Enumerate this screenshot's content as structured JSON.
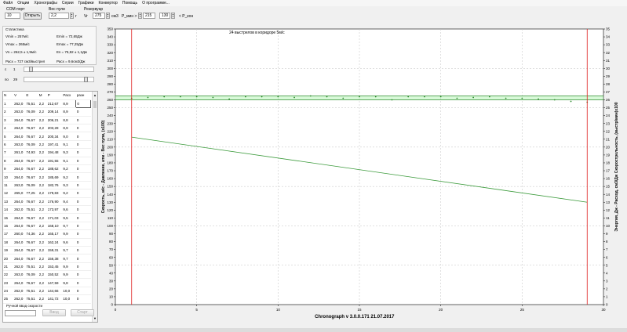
{
  "menu": [
    "Файл",
    "Опции",
    "Хронографы",
    "Серии",
    "Графики",
    "Конвертор",
    "Помощь",
    "О программе..."
  ],
  "toolbar": {
    "com_label": "COM порт",
    "com_value": "10",
    "open_button": "Открыть",
    "weight_label": "Вес пули",
    "weight_value": "2,2",
    "weight_unit": "г",
    "tank_label": "Резервуар",
    "vr_label": "Vr",
    "vr_value": "275",
    "vr_unit": "см3",
    "pmin_label": "P_мин >",
    "pmin_value": "215",
    "pkon_value": "130",
    "pkon_label": "< P_кон"
  },
  "stats": {
    "title": "Статистика",
    "vmin": "Vmin = 257м/с",
    "emin": "Emin = 72,65Дж",
    "vmax": "Vmax = 265м/с",
    "emax": "Emax = 77,25Дж",
    "vavg": "Vs = 262,5 ± 1,9м/с",
    "eavg": "Es = 75,82 ± 1,1Дж",
    "flow": "Расх = 727 см3/выстрел",
    "flow2": "Расх = 9,6см3/Дж"
  },
  "range": {
    "from_label": "с",
    "from_value": "1",
    "to_label": "по",
    "to_value": "29"
  },
  "table": {
    "headers": [
      "N",
      "V",
      "E",
      "M",
      "P",
      "Расх",
      "разн"
    ],
    "rows": [
      [
        "1",
        "262,0",
        "75,51",
        "2,2",
        "212,67",
        "8,9",
        "0"
      ],
      [
        "2",
        "263,0",
        "76,09",
        "2,2",
        "209,14",
        "8,9",
        "0"
      ],
      [
        "3",
        "264,0",
        "76,67",
        "2,2",
        "206,21",
        "8,8",
        "0"
      ],
      [
        "4",
        "264,0",
        "76,67",
        "2,2",
        "203,28",
        "8,9",
        "0"
      ],
      [
        "5",
        "264,0",
        "76,67",
        "2,2",
        "200,34",
        "9,0",
        "0"
      ],
      [
        "6",
        "263,0",
        "76,09",
        "2,2",
        "197,41",
        "9,1",
        "0"
      ],
      [
        "7",
        "261,0",
        "74,93",
        "2,2",
        "194,48",
        "9,3",
        "0"
      ],
      [
        "8",
        "264,0",
        "76,67",
        "2,2",
        "191,55",
        "9,1",
        "0"
      ],
      [
        "9",
        "264,0",
        "76,67",
        "2,2",
        "188,62",
        "9,2",
        "0"
      ],
      [
        "10",
        "264,0",
        "76,67",
        "2,2",
        "185,69",
        "9,2",
        "0"
      ],
      [
        "11",
        "263,0",
        "76,09",
        "2,2",
        "182,76",
        "9,3",
        "0"
      ],
      [
        "12",
        "265,0",
        "77,25",
        "2,2",
        "179,83",
        "9,2",
        "0"
      ],
      [
        "13",
        "264,0",
        "76,67",
        "2,2",
        "176,90",
        "9,4",
        "0"
      ],
      [
        "14",
        "262,0",
        "75,51",
        "2,2",
        "173,97",
        "9,6",
        "0"
      ],
      [
        "15",
        "264,0",
        "76,67",
        "2,2",
        "171,03",
        "9,5",
        "0"
      ],
      [
        "16",
        "264,0",
        "76,67",
        "2,2",
        "168,10",
        "9,7",
        "0"
      ],
      [
        "17",
        "260,0",
        "74,36",
        "2,2",
        "165,17",
        "9,9",
        "0"
      ],
      [
        "18",
        "264,0",
        "76,67",
        "2,2",
        "162,24",
        "9,6",
        "0"
      ],
      [
        "19",
        "264,0",
        "76,67",
        "2,2",
        "159,31",
        "9,7",
        "0"
      ],
      [
        "20",
        "264,0",
        "76,67",
        "2,2",
        "156,38",
        "9,7",
        "0"
      ],
      [
        "21",
        "262,0",
        "75,51",
        "2,2",
        "153,45",
        "9,9",
        "0"
      ],
      [
        "22",
        "263,0",
        "76,09",
        "2,2",
        "150,52",
        "9,9",
        "0"
      ],
      [
        "23",
        "264,0",
        "76,67",
        "2,2",
        "147,59",
        "9,8",
        "0"
      ],
      [
        "24",
        "262,0",
        "75,51",
        "2,2",
        "144,66",
        "10,0",
        "0"
      ],
      [
        "25",
        "262,0",
        "75,51",
        "2,2",
        "141,72",
        "10,0",
        "0"
      ]
    ]
  },
  "manual": {
    "label": "Ручной ввод скорости",
    "enter_button": "Ввод",
    "start_button": "Старт"
  },
  "chart_data": {
    "type": "line",
    "title": "24 выстрелов в коридоре 5м/с",
    "footer": "Chronograph v 3.0.0.171      21.07.2017",
    "ylabel_left": "Скорость, м/с  -  Давление, атм  -  Вес пули, (х100)",
    "ylabel_right": "Энергия, Дж  -  Расход, см3/Дж   Скорострельность, (выстр/мин)х100",
    "xlim": [
      0,
      30
    ],
    "ylim_left": [
      0,
      350
    ],
    "ylim_right": [
      0,
      35
    ],
    "x_ticks": [
      0,
      5,
      10,
      15,
      20,
      25,
      30
    ],
    "y_ticks_left": [
      0,
      10,
      20,
      30,
      40,
      50,
      60,
      70,
      80,
      90,
      100,
      110,
      120,
      130,
      140,
      150,
      160,
      170,
      180,
      190,
      200,
      210,
      220,
      230,
      240,
      250,
      260,
      270,
      280,
      290,
      300,
      310,
      320,
      330,
      340,
      350
    ],
    "y_ticks_right": [
      0,
      1,
      2,
      3,
      4,
      5,
      6,
      7,
      8,
      9,
      10,
      11,
      12,
      13,
      14,
      15,
      16,
      17,
      18,
      19,
      20,
      21,
      22,
      23,
      24,
      25,
      26,
      27,
      28,
      29,
      30,
      31,
      32,
      33,
      34,
      35
    ],
    "grid": true,
    "corridor": [
      260,
      265
    ],
    "vertical_markers": [
      1,
      29
    ],
    "series": [
      {
        "values": [
          [
            1,
            262
          ],
          [
            2,
            263
          ],
          [
            3,
            264
          ],
          [
            4,
            264
          ],
          [
            5,
            264
          ],
          [
            6,
            263
          ],
          [
            7,
            261
          ],
          [
            8,
            264
          ],
          [
            9,
            264
          ],
          [
            10,
            264
          ],
          [
            11,
            263
          ],
          [
            12,
            265
          ],
          [
            13,
            264
          ],
          [
            14,
            262
          ],
          [
            15,
            264
          ],
          [
            16,
            264
          ],
          [
            17,
            260
          ],
          [
            18,
            264
          ],
          [
            19,
            264
          ],
          [
            20,
            264
          ],
          [
            21,
            262
          ],
          [
            22,
            263
          ],
          [
            23,
            264
          ],
          [
            24,
            262
          ],
          [
            25,
            262
          ],
          [
            26,
            261
          ],
          [
            27,
            260
          ],
          [
            28,
            258
          ],
          [
            29,
            257
          ]
        ]
      },
      {
        "values": [
          [
            1,
            212.67
          ],
          [
            29,
            130
          ]
        ]
      }
    ],
    "colors": {
      "velocity": "#2e8b2e",
      "pressure": "#3a9a3a",
      "corridor": "#90ee90",
      "marker": "#e02020",
      "grid": "#c0c0c0"
    }
  }
}
